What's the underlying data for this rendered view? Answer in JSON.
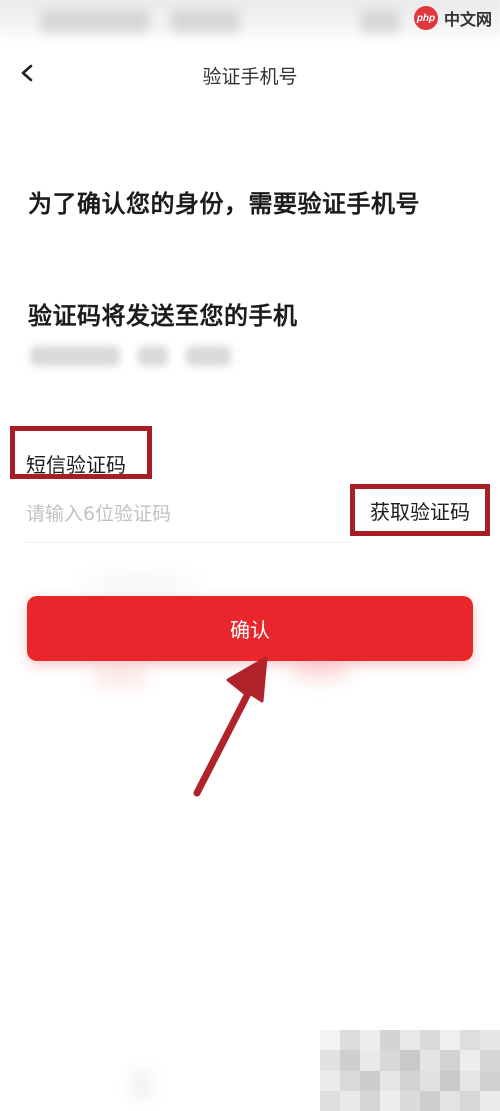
{
  "watermark": {
    "logo_text": "php",
    "label": "中文网"
  },
  "nav": {
    "title": "验证手机号",
    "back_icon": "chevron-left-icon"
  },
  "content": {
    "heading": "为了确认您的身份，需要验证手机号",
    "subheading": "验证码将发送至您的手机"
  },
  "form": {
    "sms_label": "短信验证码",
    "code_placeholder": "请输入6位验证码",
    "code_value": "",
    "get_code_label": "获取验证码"
  },
  "actions": {
    "confirm_label": "确认"
  },
  "colors": {
    "accent": "#e8262b",
    "highlight": "#a91d24",
    "annotation_arrow": "#b0232a"
  }
}
